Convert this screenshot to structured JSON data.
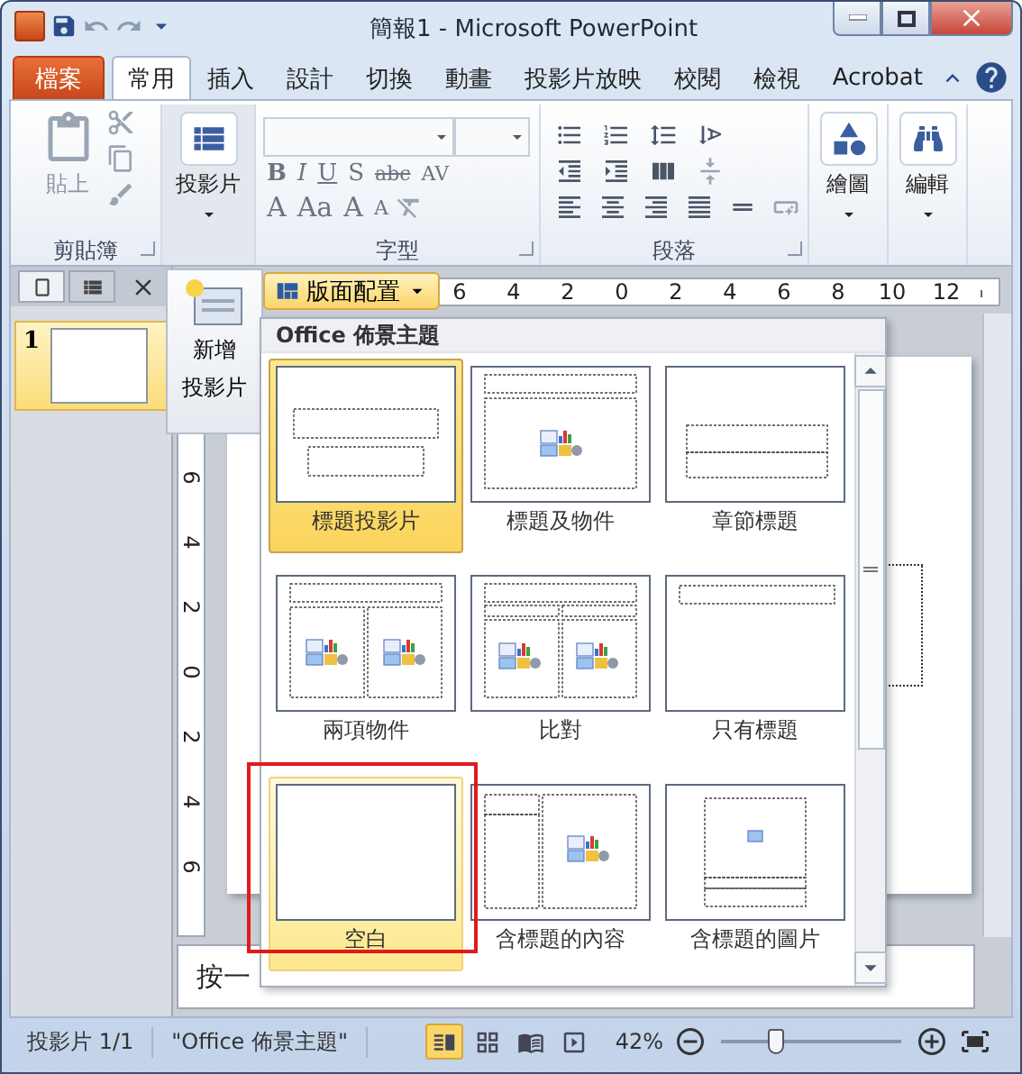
{
  "window": {
    "title": "簡報1  -  Microsoft PowerPoint"
  },
  "tabs": [
    {
      "label": "檔案",
      "kind": "file",
      "selected": false
    },
    {
      "label": "常用",
      "kind": "tab",
      "selected": true
    },
    {
      "label": "插入",
      "kind": "tab",
      "selected": false
    },
    {
      "label": "設計",
      "kind": "tab",
      "selected": false
    },
    {
      "label": "切換",
      "kind": "tab",
      "selected": false
    },
    {
      "label": "動畫",
      "kind": "tab",
      "selected": false
    },
    {
      "label": "投影片放映",
      "kind": "tab",
      "selected": false
    },
    {
      "label": "校閱",
      "kind": "tab",
      "selected": false
    },
    {
      "label": "檢視",
      "kind": "tab",
      "selected": false
    },
    {
      "label": "Acrobat",
      "kind": "tab",
      "selected": false
    }
  ],
  "ribbon": {
    "clipboard": {
      "paste": "貼上",
      "label": "剪貼簿"
    },
    "slides": {
      "button": "投影片"
    },
    "font": {
      "label": "字型",
      "format_buttons": [
        "B",
        "I",
        "U",
        "S",
        "abc",
        "AV"
      ],
      "size_buttons": [
        "A",
        "Aa",
        "A",
        "A"
      ]
    },
    "paragraph": {
      "label": "段落"
    },
    "drawing": {
      "button": "繪圖"
    },
    "editing": {
      "button": "編輯"
    }
  },
  "slide_pane": {
    "thumbnails": [
      {
        "number": "1",
        "selected": true
      }
    ]
  },
  "new_slide": {
    "lines": [
      "新增",
      "投影片"
    ]
  },
  "layout_button": {
    "label": "版面配置"
  },
  "ruler": {
    "horizontal": [
      "6",
      "4",
      "2",
      "0",
      "2",
      "4",
      "6",
      "8",
      "10",
      "12"
    ],
    "vertical": [
      "6",
      "4",
      "2",
      "0",
      "2",
      "4",
      "6"
    ]
  },
  "gallery": {
    "title": "Office 佈景主題",
    "layouts": [
      {
        "label": "標題投影片",
        "kind": "title",
        "selected": true,
        "hovered": false,
        "marked": false
      },
      {
        "label": "標題及物件",
        "kind": "title_content",
        "selected": false,
        "hovered": false,
        "marked": false
      },
      {
        "label": "章節標題",
        "kind": "section",
        "selected": false,
        "hovered": false,
        "marked": false
      },
      {
        "label": "兩項物件",
        "kind": "two_content",
        "selected": false,
        "hovered": false,
        "marked": false
      },
      {
        "label": "比對",
        "kind": "comparison",
        "selected": false,
        "hovered": false,
        "marked": false
      },
      {
        "label": "只有標題",
        "kind": "title_only",
        "selected": false,
        "hovered": false,
        "marked": false
      },
      {
        "label": "空白",
        "kind": "blank",
        "selected": false,
        "hovered": true,
        "marked": true
      },
      {
        "label": "含標題的內容",
        "kind": "content_caption",
        "selected": false,
        "hovered": false,
        "marked": false
      },
      {
        "label": "含標題的圖片",
        "kind": "picture_caption",
        "selected": false,
        "hovered": false,
        "marked": false
      }
    ]
  },
  "notes": {
    "text": "按一"
  },
  "status_bar": {
    "slide": "投影片 1/1",
    "theme": "\"Office 佈景主題\"",
    "views": [
      {
        "kind": "normal",
        "selected": true
      },
      {
        "kind": "sorter",
        "selected": false
      },
      {
        "kind": "reading",
        "selected": false
      },
      {
        "kind": "show",
        "selected": false
      }
    ],
    "zoom": {
      "reading": "42%",
      "level": 0.3
    }
  }
}
